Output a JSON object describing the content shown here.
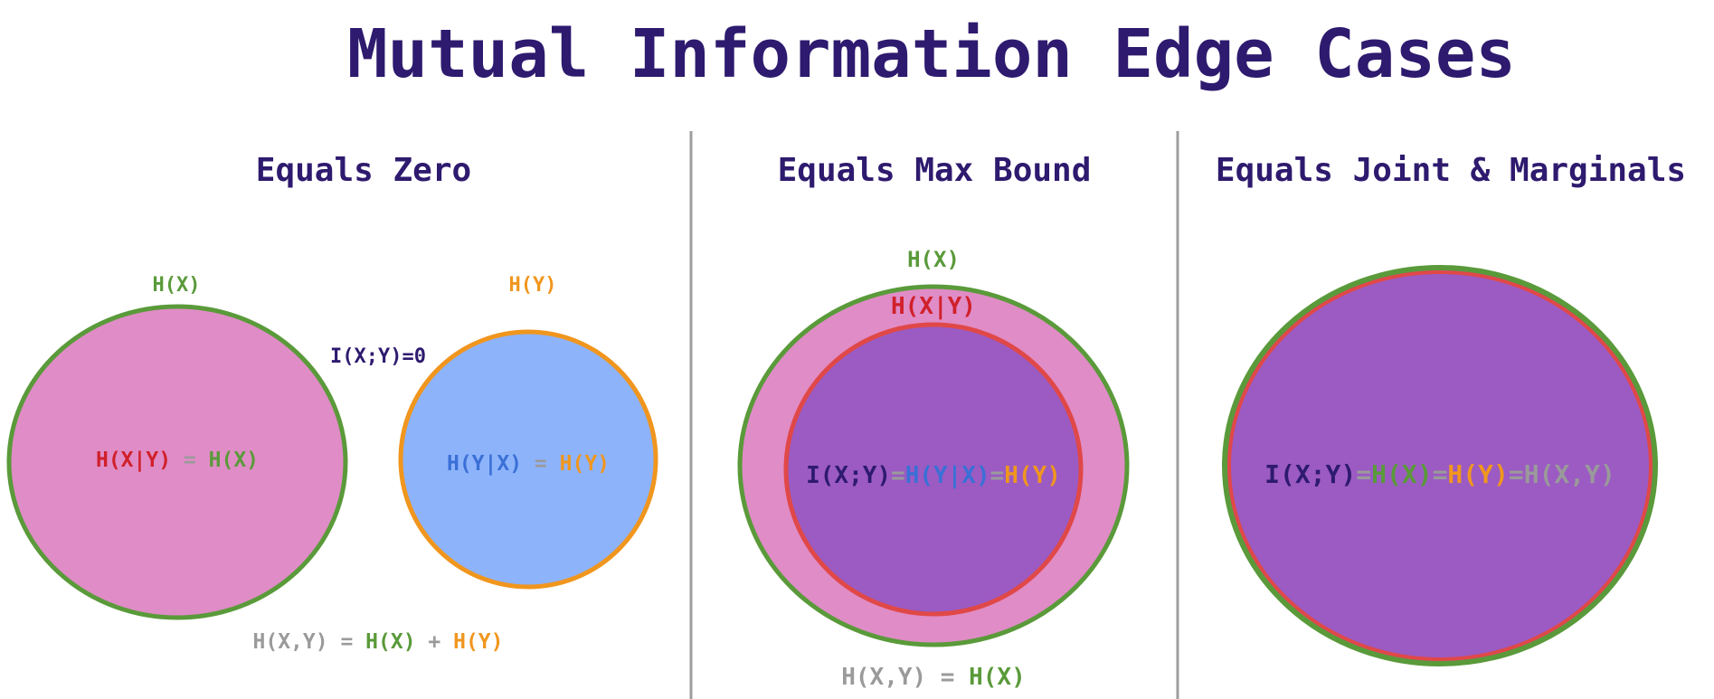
{
  "title": "Mutual Information Edge Cases",
  "colors": {
    "title": "#2e1a6e",
    "divider": "#9e9e9e",
    "green": "#5a9a3a",
    "orange": "#f0961e",
    "red": "#d0202a",
    "blue": "#3a70d6",
    "gray": "#9a9a9a",
    "navy": "#2e1a6e",
    "pink_fill": "#e08cc6",
    "blue_fill": "#8db3fb",
    "purple_fill": "#9b5bc3",
    "red_ring": "#e04848"
  },
  "panels": {
    "zero": {
      "heading": "Equals Zero",
      "hx_label": "H(X)",
      "hy_label": "H(Y)",
      "mi_label": "I(X;Y)=0",
      "left_eq": [
        "H(X|Y)",
        " = ",
        "H(X)"
      ],
      "right_eq": [
        "H(Y|X)",
        " = ",
        "H(Y)"
      ],
      "joint_eq": [
        "H(X,Y)",
        " = ",
        "H(X)",
        " + ",
        "H(Y)"
      ]
    },
    "max": {
      "heading": "Equals Max Bound",
      "hx_label": "H(X)",
      "hxy_label": "H(X|Y)",
      "center_eq": [
        "I(X;Y)",
        "=",
        "H(Y|X)",
        "=",
        "H(Y)"
      ],
      "joint_eq": [
        "H(X,Y)",
        " = ",
        "H(X)"
      ]
    },
    "joint": {
      "heading": "Equals Joint & Marginals",
      "center_eq": [
        "I(X;Y)",
        "=",
        "H(X)",
        "=",
        "H(Y)",
        "=",
        "H(X,Y)"
      ]
    }
  }
}
